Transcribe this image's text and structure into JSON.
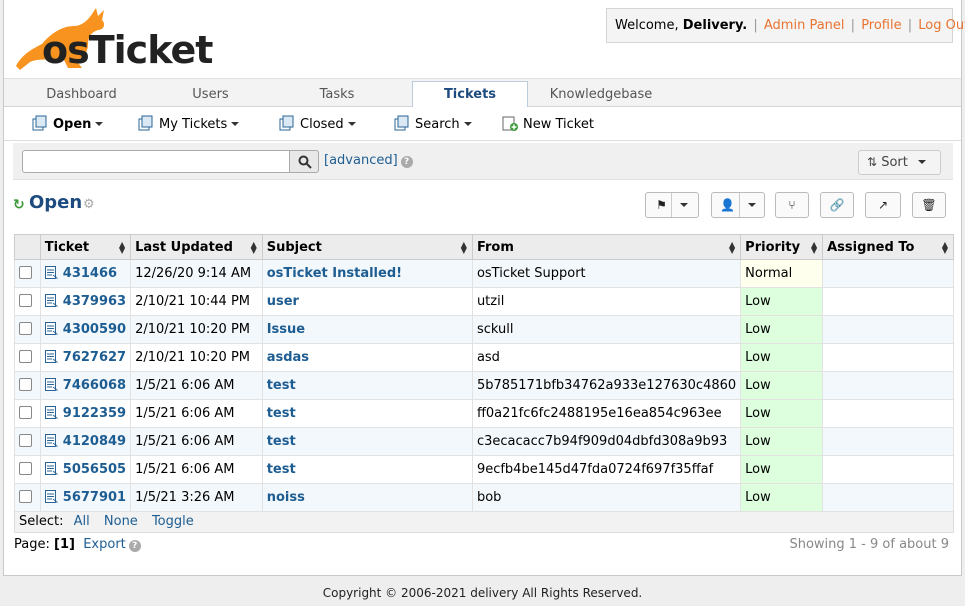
{
  "header": {
    "logo_text": "osTicket",
    "welcome_prefix": "Welcome,",
    "user_name": "Delivery.",
    "links": [
      "Admin Panel",
      "Profile",
      "Log Out"
    ]
  },
  "nav": {
    "tabs": [
      "Dashboard",
      "Users",
      "Tasks",
      "Tickets",
      "Knowledgebase"
    ],
    "active": "Tickets"
  },
  "subnav": {
    "items": [
      "Open",
      "My Tickets",
      "Closed",
      "Search",
      "New Ticket"
    ]
  },
  "search": {
    "placeholder": "",
    "advanced_label": "[advanced]",
    "sort_label": "Sort"
  },
  "queue": {
    "title": "Open"
  },
  "table": {
    "columns": [
      "Ticket",
      "Last Updated",
      "Subject",
      "From",
      "Priority",
      "Assigned To"
    ],
    "rows": [
      {
        "ticket": "431466",
        "updated": "12/26/20 9:14 AM",
        "subject": "osTicket Installed!",
        "from": "osTicket Support",
        "priority": "Normal",
        "assigned": ""
      },
      {
        "ticket": "4379963",
        "updated": "2/10/21 10:44 PM",
        "subject": "user",
        "from": "utzil",
        "priority": "Low",
        "assigned": ""
      },
      {
        "ticket": "4300590",
        "updated": "2/10/21 10:20 PM",
        "subject": "Issue",
        "from": "sckull",
        "priority": "Low",
        "assigned": ""
      },
      {
        "ticket": "7627627",
        "updated": "2/10/21 10:20 PM",
        "subject": "asdas",
        "from": "asd",
        "priority": "Low",
        "assigned": ""
      },
      {
        "ticket": "7466068",
        "updated": "1/5/21 6:06 AM",
        "subject": "test",
        "from": "5b785171bfb34762a933e127630c4860",
        "priority": "Low",
        "assigned": ""
      },
      {
        "ticket": "9122359",
        "updated": "1/5/21 6:06 AM",
        "subject": "test",
        "from": "ff0a21fc6fc2488195e16ea854c963ee",
        "priority": "Low",
        "assigned": ""
      },
      {
        "ticket": "4120849",
        "updated": "1/5/21 6:06 AM",
        "subject": "test",
        "from": "c3ecacacc7b94f909d04dbfd308a9b93",
        "priority": "Low",
        "assigned": ""
      },
      {
        "ticket": "5056505",
        "updated": "1/5/21 6:06 AM",
        "subject": "test",
        "from": "9ecfb4be145d47fda0724f697f35ffaf",
        "priority": "Low",
        "assigned": ""
      },
      {
        "ticket": "5677901",
        "updated": "1/5/21 3:26 AM",
        "subject": "noiss",
        "from": "bob",
        "priority": "Low",
        "assigned": ""
      }
    ]
  },
  "select_bar": {
    "label": "Select:",
    "options": [
      "All",
      "None",
      "Toggle"
    ]
  },
  "pagination": {
    "label": "Page:",
    "current": "[1]",
    "export_label": "Export",
    "showing": "Showing 1 - 9 of about 9"
  },
  "footer": {
    "copyright": "Copyright © 2006-2021 delivery All Rights Reserved."
  },
  "colors": {
    "link": "#1d5d92",
    "header_link": "#e87431",
    "priority_low_bg": "#ddffdd",
    "priority_normal_bg": "#ffffee"
  }
}
